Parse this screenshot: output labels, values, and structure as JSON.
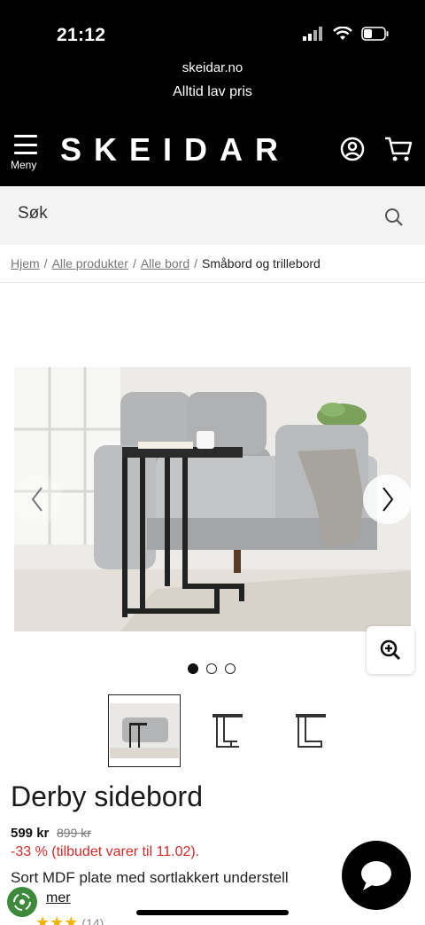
{
  "status": {
    "time": "21:12"
  },
  "header": {
    "site": "skeidar.no",
    "tagline": "Alltid lav pris",
    "menu_label": "Meny",
    "logo": "SKEIDAR",
    "icons": [
      "user-icon",
      "cart-icon",
      "menu-icon"
    ]
  },
  "search": {
    "placeholder": "Søk"
  },
  "breadcrumb": {
    "items": [
      "Hjem",
      "Alle produkter",
      "Alle bord"
    ],
    "current": "Småbord og trillebord"
  },
  "gallery": {
    "image_count": 3,
    "active_index": 0
  },
  "product": {
    "title": "Derby sidebord",
    "price": "599 kr",
    "old_price": "899 kr",
    "discount": "-33 % (tilbudet varer til 11.02).",
    "description": "Sort MDF plate med sortlakkert understell",
    "more_label": "mer",
    "reviews": "(14)"
  },
  "colors": {
    "header_bg": "#000000",
    "discount": "#d02a2a",
    "search_bg": "#f3f3f3"
  }
}
